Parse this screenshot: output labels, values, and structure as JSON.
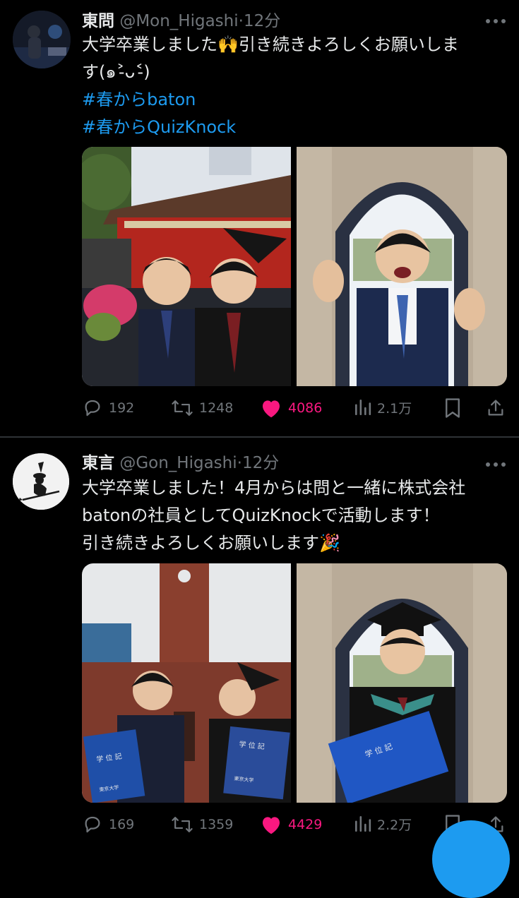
{
  "tweets": [
    {
      "name": "東問",
      "handle": "@Mon_Higashi",
      "dot": "·",
      "time": "12分",
      "lines": [
        "大学卒業しました🙌引き続きよろしくお願いしま",
        "す(๑˃̵ᴗ˂̵)"
      ],
      "hashtags": [
        "#春からbaton",
        "#春からQuizKnock"
      ],
      "replies": "192",
      "retweets": "1248",
      "likes": "4086",
      "views": "2.1万"
    },
    {
      "name": "東言",
      "handle": "@Gon_Higashi",
      "dot": "·",
      "time": "12分",
      "lines": [
        "大学卒業しました！4月からは問と一緒に株式会社",
        "batonの社員としてQuizKnockで活動します！",
        "引き続きよろしくお願いします🎉"
      ],
      "replies": "169",
      "retweets": "1359",
      "likes": "4429",
      "views": "2.2万"
    }
  ],
  "photo_text": {
    "diploma_title": "学 位 記",
    "university": "東京大学"
  },
  "icons": [
    "more-icon",
    "reply-icon",
    "retweet-icon",
    "like-icon",
    "views-icon",
    "bookmark-icon",
    "share-icon"
  ],
  "colors": {
    "accent": "#1d9bf0",
    "like": "#f91880",
    "muted": "#71767b",
    "text": "#e7e9ea",
    "bg": "#000000"
  }
}
